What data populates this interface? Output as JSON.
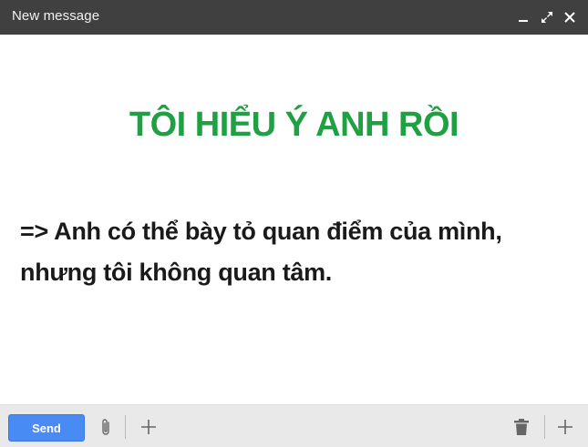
{
  "window": {
    "title": "New message",
    "controls": {
      "minimize": "minimize-icon",
      "maximize": "expand-icon",
      "close": "close-icon"
    }
  },
  "message": {
    "heading": "TÔI HIỂU Ý ANH RỒI",
    "lines": [
      "=> Anh có thể bày tỏ quan điểm của mình,",
      "nhưng tôi không quan tâm."
    ]
  },
  "toolbar": {
    "send_label": "Send",
    "icons": [
      "paperclip-icon",
      "plus-icon",
      "trash-icon",
      "plus-icon"
    ]
  },
  "colors": {
    "titlebar": "#404040",
    "heading": "#1fa043",
    "send_button": "#4a8af4",
    "toolbar_bg": "#e9e9e9"
  }
}
